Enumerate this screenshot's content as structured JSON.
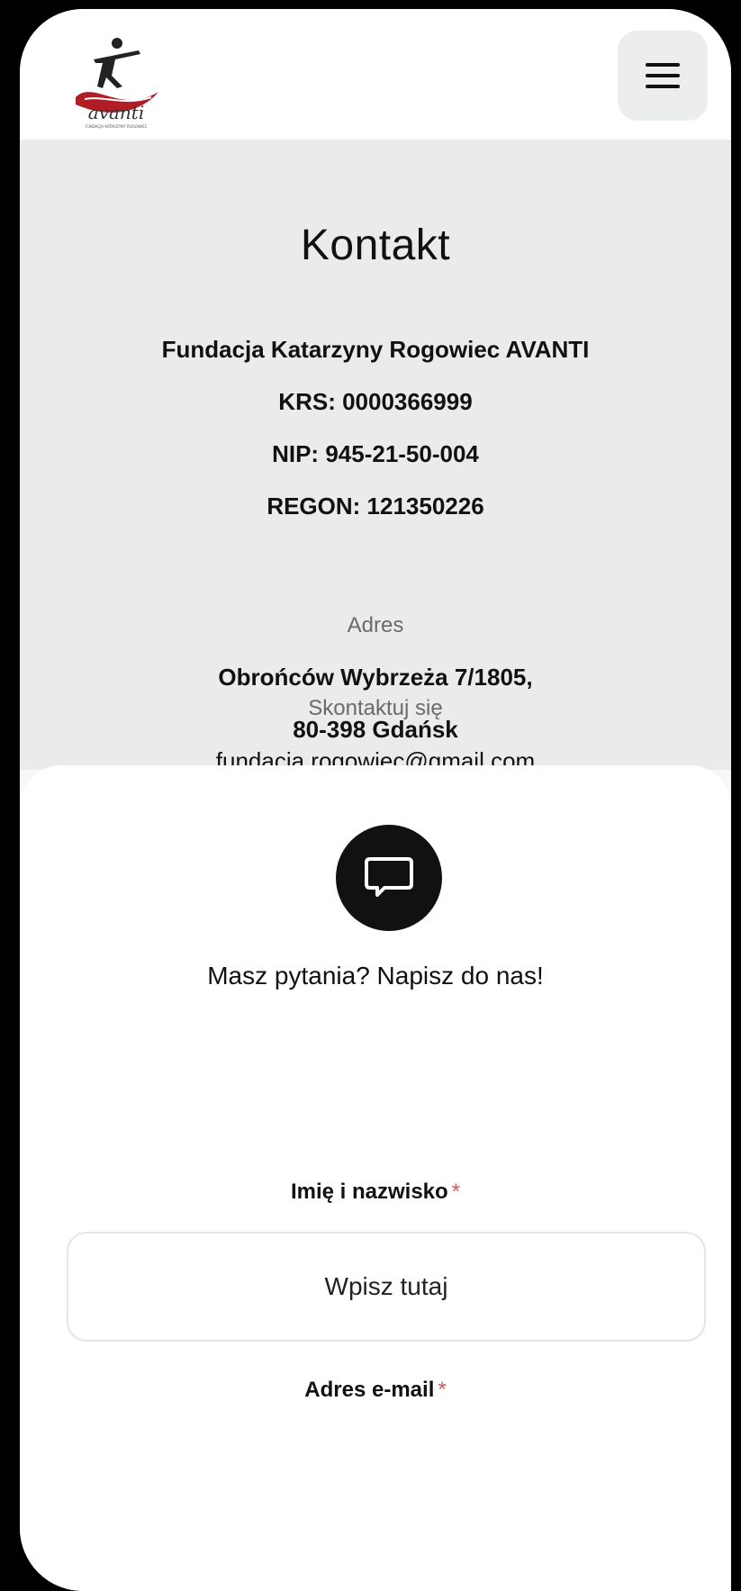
{
  "header": {
    "logo_text": "avanti",
    "logo_subtext": "FUNDACJA KATARZYNY ROGOWIEC",
    "menu_icon": "hamburger-menu-icon"
  },
  "contact": {
    "title": "Kontakt",
    "org_name": "Fundacja Katarzyny Rogowiec AVANTI",
    "krs": "KRS: 0000366999",
    "nip": "NIP: 945-21-50-004",
    "regon": "REGON: 121350226",
    "address_label": "Adres",
    "address_line1": "Obrońców Wybrzeża 7/1805,",
    "address_line2": "80-398 Gdańsk",
    "reach_label": "Skontaktuj się",
    "email": "fundacja.rogowiec@gmail.com"
  },
  "form": {
    "icon": "chat-bubble-icon",
    "heading": "Masz pytania? Napisz do nas!",
    "name_label": "Imię i nazwisko",
    "name_placeholder": "Wpisz tutaj",
    "email_label": "Adres e-mail",
    "required_marker": "*"
  },
  "colors": {
    "brand_red": "#b01d24",
    "required": "#d05a5a",
    "dark": "#111111"
  }
}
